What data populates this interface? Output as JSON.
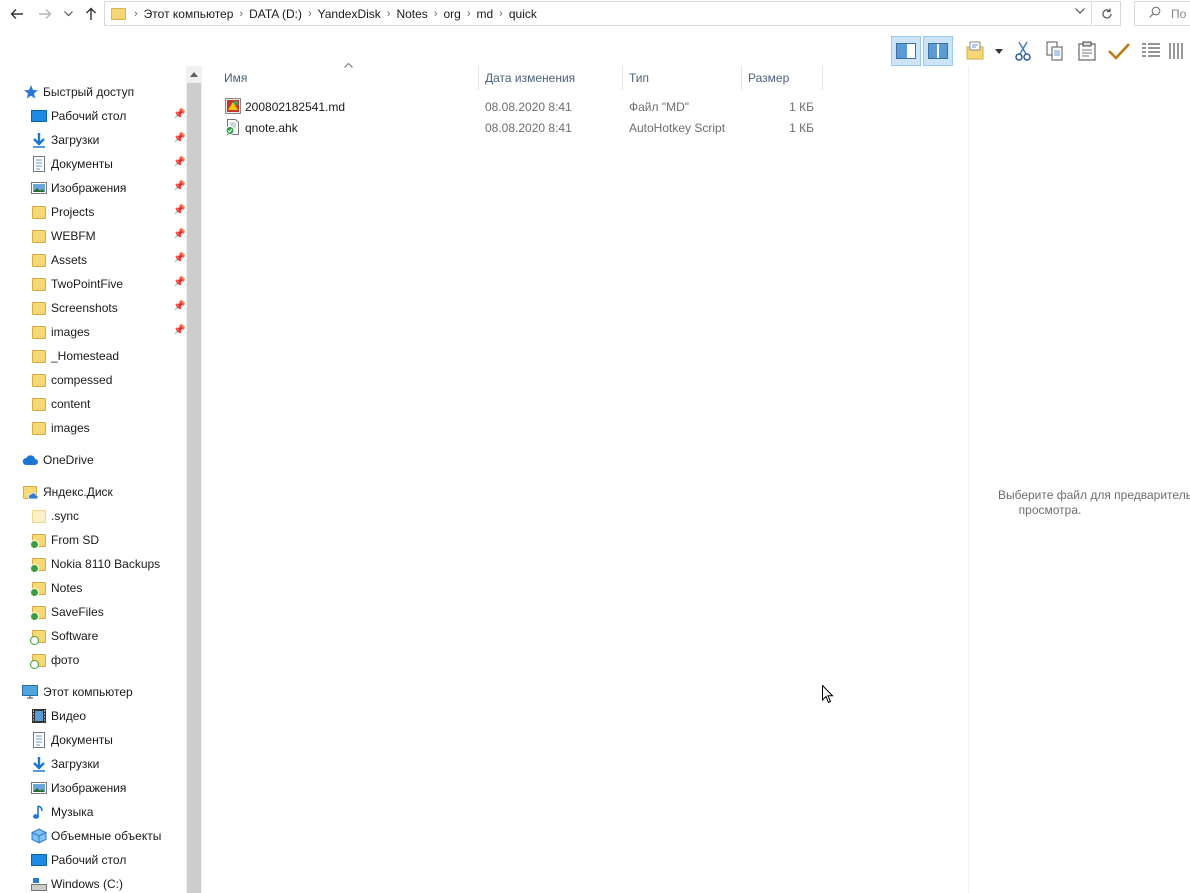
{
  "address_bar": {
    "breadcrumbs": [
      "Этот компьютер",
      "DATA (D:)",
      "YandexDisk",
      "Notes",
      "org",
      "md",
      "quick"
    ],
    "search_placeholder": "По"
  },
  "nav_pane": {
    "quick_access": {
      "label": "Быстрый доступ",
      "items": [
        {
          "label": "Рабочий стол",
          "icon": "desktop-icon",
          "pinned": true
        },
        {
          "label": "Загрузки",
          "icon": "downloads-icon",
          "pinned": true
        },
        {
          "label": "Документы",
          "icon": "documents-icon",
          "pinned": true
        },
        {
          "label": "Изображения",
          "icon": "pictures-icon",
          "pinned": true
        },
        {
          "label": "Projects",
          "icon": "folder-icon",
          "pinned": true
        },
        {
          "label": "WEBFM",
          "icon": "folder-icon",
          "pinned": true
        },
        {
          "label": "Assets",
          "icon": "folder-icon",
          "pinned": true
        },
        {
          "label": "TwoPointFive",
          "icon": "folder-icon",
          "pinned": true
        },
        {
          "label": "Screenshots",
          "icon": "folder-icon",
          "pinned": true
        },
        {
          "label": "images",
          "icon": "folder-icon",
          "pinned": true
        },
        {
          "label": "_Homestead",
          "icon": "folder-icon",
          "pinned": false
        },
        {
          "label": "compessed",
          "icon": "folder-icon",
          "pinned": false
        },
        {
          "label": "content",
          "icon": "folder-icon",
          "pinned": false
        },
        {
          "label": "images",
          "icon": "folder-icon",
          "pinned": false
        }
      ]
    },
    "onedrive": {
      "label": "OneDrive"
    },
    "yandex": {
      "label": "Яндекс.Диск",
      "items": [
        {
          "label": ".sync",
          "icon": "folder-icon",
          "badge": "none"
        },
        {
          "label": "From SD",
          "icon": "folder-icon",
          "badge": "synced"
        },
        {
          "label": "Nokia 8110 Backups",
          "icon": "folder-icon",
          "badge": "synced"
        },
        {
          "label": "Notes",
          "icon": "folder-icon",
          "badge": "synced"
        },
        {
          "label": "SaveFiles",
          "icon": "folder-icon",
          "badge": "synced"
        },
        {
          "label": "Software",
          "icon": "folder-icon",
          "badge": "available"
        },
        {
          "label": "фото",
          "icon": "folder-icon",
          "badge": "available"
        }
      ]
    },
    "this_pc": {
      "label": "Этот компьютер",
      "items": [
        {
          "label": "Видео",
          "icon": "video-icon"
        },
        {
          "label": "Документы",
          "icon": "documents-icon"
        },
        {
          "label": "Загрузки",
          "icon": "downloads-icon"
        },
        {
          "label": "Изображения",
          "icon": "pictures-icon"
        },
        {
          "label": "Музыка",
          "icon": "music-icon"
        },
        {
          "label": "Объемные объекты",
          "icon": "3d-objects-icon"
        },
        {
          "label": "Рабочий стол",
          "icon": "desktop-icon"
        },
        {
          "label": "Windows (C:)",
          "icon": "drive-icon"
        }
      ]
    }
  },
  "columns": {
    "name": "Имя",
    "date": "Дата изменения",
    "type": "Тип",
    "size": "Размер"
  },
  "files": [
    {
      "name": "200802182541.md",
      "date": "08.08.2020 8:41",
      "type": "Файл \"MD\"",
      "size": "1 КБ",
      "icon": "md-file-icon"
    },
    {
      "name": "qnote.ahk",
      "date": "08.08.2020 8:41",
      "type": "AutoHotkey Script",
      "size": "1 КБ",
      "icon": "ahk-file-icon"
    }
  ],
  "preview": {
    "line1": "Выберите файл для предварительного",
    "line2": "просмотра."
  }
}
